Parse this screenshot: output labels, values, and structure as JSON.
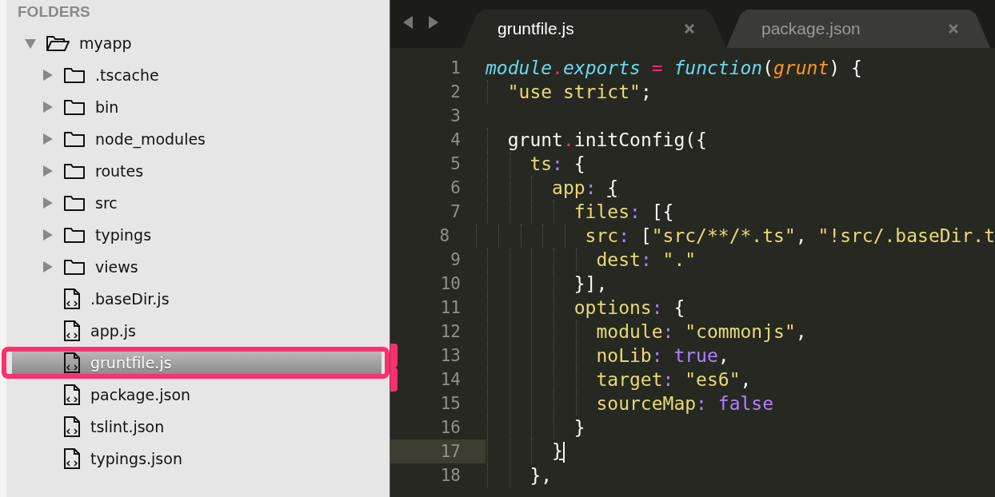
{
  "sidebar": {
    "heading": "FOLDERS",
    "tree": [
      {
        "name": "myapp",
        "kind": "folder",
        "expanded": true,
        "selected": false,
        "annotated": false,
        "children": [
          {
            "name": ".tscache",
            "kind": "folder",
            "expanded": false,
            "selected": false,
            "annotated": false
          },
          {
            "name": "bin",
            "kind": "folder",
            "expanded": false,
            "selected": false,
            "annotated": false
          },
          {
            "name": "node_modules",
            "kind": "folder",
            "expanded": false,
            "selected": false,
            "annotated": false
          },
          {
            "name": "routes",
            "kind": "folder",
            "expanded": false,
            "selected": false,
            "annotated": false
          },
          {
            "name": "src",
            "kind": "folder",
            "expanded": false,
            "selected": false,
            "annotated": false
          },
          {
            "name": "typings",
            "kind": "folder",
            "expanded": false,
            "selected": false,
            "annotated": false
          },
          {
            "name": "views",
            "kind": "folder",
            "expanded": false,
            "selected": false,
            "annotated": false
          },
          {
            "name": ".baseDir.js",
            "kind": "file",
            "selected": false,
            "annotated": false
          },
          {
            "name": "app.js",
            "kind": "file",
            "selected": false,
            "annotated": false
          },
          {
            "name": "gruntfile.js",
            "kind": "file",
            "selected": true,
            "annotated": true
          },
          {
            "name": "package.json",
            "kind": "file",
            "selected": false,
            "annotated": false
          },
          {
            "name": "tslint.json",
            "kind": "file",
            "selected": false,
            "annotated": false
          },
          {
            "name": "typings.json",
            "kind": "file",
            "selected": false,
            "annotated": false
          }
        ]
      }
    ]
  },
  "editor": {
    "tabs": [
      {
        "label": "gruntfile.js",
        "selected": true
      },
      {
        "label": "package.json",
        "selected": false
      }
    ],
    "lines": [
      {
        "number": "1",
        "current": false,
        "marked": false,
        "tokens": [
          {
            "text": "module",
            "kind": "object"
          },
          {
            "text": ".",
            "kind": "operator"
          },
          {
            "text": "exports",
            "kind": "object"
          },
          {
            "text": " = ",
            "kind": "operator"
          },
          {
            "text": "function",
            "kind": "object"
          },
          {
            "text": "(",
            "kind": "plain"
          },
          {
            "text": "grunt",
            "kind": "param"
          },
          {
            "text": ") {",
            "kind": "plain"
          }
        ]
      },
      {
        "number": "2",
        "current": false,
        "marked": false,
        "tokens": [
          {
            "text": "  \"use strict\"",
            "kind": "string"
          },
          {
            "text": ";",
            "kind": "plain"
          }
        ]
      },
      {
        "number": "3",
        "current": false,
        "marked": false
      },
      {
        "number": "4",
        "current": false,
        "marked": false,
        "tokens": [
          {
            "text": "  grunt",
            "kind": "plain"
          },
          {
            "text": ".",
            "kind": "operator"
          },
          {
            "text": "initConfig({",
            "kind": "plain"
          }
        ]
      },
      {
        "number": "5",
        "current": false,
        "marked": false,
        "tokens": [
          {
            "text": "    ts",
            "kind": "key"
          },
          {
            "text": ":",
            "kind": "colon"
          },
          {
            "text": " {",
            "kind": "plain"
          }
        ]
      },
      {
        "number": "6",
        "current": false,
        "marked": false,
        "tokens": [
          {
            "text": "      app",
            "kind": "key"
          },
          {
            "text": ": ",
            "kind": "colon"
          },
          {
            "text": "{",
            "kind": "match"
          }
        ]
      },
      {
        "number": "7",
        "current": false,
        "marked": false,
        "tokens": [
          {
            "text": "        files",
            "kind": "key"
          },
          {
            "text": ":",
            "kind": "colon"
          },
          {
            "text": " [{",
            "kind": "plain"
          }
        ]
      },
      {
        "number": "8",
        "current": false,
        "marked": false,
        "tokens": [
          {
            "text": "          src",
            "kind": "key"
          },
          {
            "text": ":",
            "kind": "colon"
          },
          {
            "text": " [",
            "kind": "plain"
          },
          {
            "text": "\"src/**/*.ts\"",
            "kind": "string"
          },
          {
            "text": ", ",
            "kind": "plain"
          },
          {
            "text": "\"!src/.baseDir.t",
            "kind": "string"
          }
        ]
      },
      {
        "number": "9",
        "current": false,
        "marked": false,
        "tokens": [
          {
            "text": "          dest",
            "kind": "key"
          },
          {
            "text": ": ",
            "kind": "colon"
          },
          {
            "text": "\".\"",
            "kind": "string"
          }
        ]
      },
      {
        "number": "10",
        "current": false,
        "marked": false,
        "tokens": [
          {
            "text": "        }],",
            "kind": "plain"
          }
        ]
      },
      {
        "number": "11",
        "current": false,
        "marked": false,
        "tokens": [
          {
            "text": "        options",
            "kind": "key"
          },
          {
            "text": ":",
            "kind": "colon"
          },
          {
            "text": " {",
            "kind": "plain"
          }
        ]
      },
      {
        "number": "12",
        "current": false,
        "marked": false,
        "tokens": [
          {
            "text": "          module",
            "kind": "key"
          },
          {
            "text": ": ",
            "kind": "colon"
          },
          {
            "text": "\"commonjs\"",
            "kind": "string"
          },
          {
            "text": ",",
            "kind": "plain"
          }
        ]
      },
      {
        "number": "13",
        "current": false,
        "marked": true,
        "tokens": [
          {
            "text": "          noLib",
            "kind": "key"
          },
          {
            "text": ": ",
            "kind": "colon"
          },
          {
            "text": "true",
            "kind": "constant"
          },
          {
            "text": ",",
            "kind": "plain"
          }
        ]
      },
      {
        "number": "14",
        "current": false,
        "marked": true,
        "tokens": [
          {
            "text": "          target",
            "kind": "key"
          },
          {
            "text": ": ",
            "kind": "colon"
          },
          {
            "text": "\"es6\"",
            "kind": "string"
          },
          {
            "text": ",",
            "kind": "plain"
          }
        ]
      },
      {
        "number": "15",
        "current": false,
        "marked": false,
        "tokens": [
          {
            "text": "          sourceMap",
            "kind": "key"
          },
          {
            "text": ": ",
            "kind": "colon"
          },
          {
            "text": "false",
            "kind": "constant"
          }
        ]
      },
      {
        "number": "16",
        "current": false,
        "marked": false,
        "tokens": [
          {
            "text": "        }",
            "kind": "plain"
          }
        ]
      },
      {
        "number": "17",
        "current": true,
        "marked": false,
        "tokens": [
          {
            "text": "      }",
            "kind": "match"
          }
        ]
      },
      {
        "number": "18",
        "current": false,
        "marked": false,
        "tokens": [
          {
            "text": "    },",
            "kind": "plain"
          }
        ]
      }
    ]
  }
}
